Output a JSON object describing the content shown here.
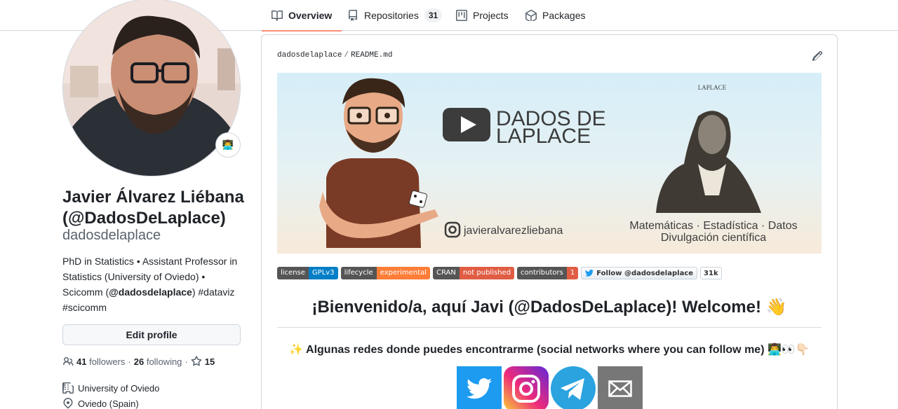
{
  "tabs": [
    {
      "label": "Overview",
      "icon": "book-icon",
      "selected": true
    },
    {
      "label": "Repositories",
      "icon": "repo-icon",
      "count": "31"
    },
    {
      "label": "Projects",
      "icon": "project-icon"
    },
    {
      "label": "Packages",
      "icon": "package-icon"
    }
  ],
  "profile": {
    "status_emoji": "👨‍💻",
    "name": "Javier Álvarez Liébana (@DadosDeLaplace)",
    "login": "dadosdelaplace",
    "bio_1": "PhD in Statistics • Assistant Professor in Statistics (University of Oviedo) • Scicomm (",
    "bio_handle": "@dadosdelaplace",
    "bio_2": ") #dataviz #scicomm",
    "edit_label": "Edit profile",
    "followers_count": "41",
    "followers_label": "followers",
    "dot": "·",
    "following_count": "26",
    "following_label": "following",
    "stars_count": "15",
    "organization": "University of Oviedo",
    "location": "Oviedo (Spain)"
  },
  "readme": {
    "owner": "dadosdelaplace",
    "separator": "/",
    "file": "README.md",
    "banner": {
      "brand_line1": "DADOS DE",
      "brand_line2": "LAPLACE",
      "laplace_caption": "LAPLACE",
      "instagram_handle": "javieralvarezliebana",
      "tagline_1": "Matemáticas · Estadística · Datos",
      "tagline_2": "Divulgación científica"
    },
    "badges": [
      {
        "key": "license",
        "value": "GPLv3",
        "color": "#007ec6"
      },
      {
        "key": "lifecycle",
        "value": "experimental",
        "color": "#fe7d37"
      },
      {
        "key": "CRAN",
        "value": "not published",
        "color": "#e05d44"
      },
      {
        "key": "contributors",
        "value": "1",
        "color": "#e05d44"
      }
    ],
    "twitter_badge": "Follow @dadosdelaplace",
    "twitter_count": "31k",
    "welcome": "¡Bienvenido/a, aquí Javi (@DadosDeLaplace)! Welcome! 👋",
    "subtitle": "✨ Algunas redes donde puedes encontrarme (social networks where you can follow me) 👨‍💻👀👇🏻"
  }
}
